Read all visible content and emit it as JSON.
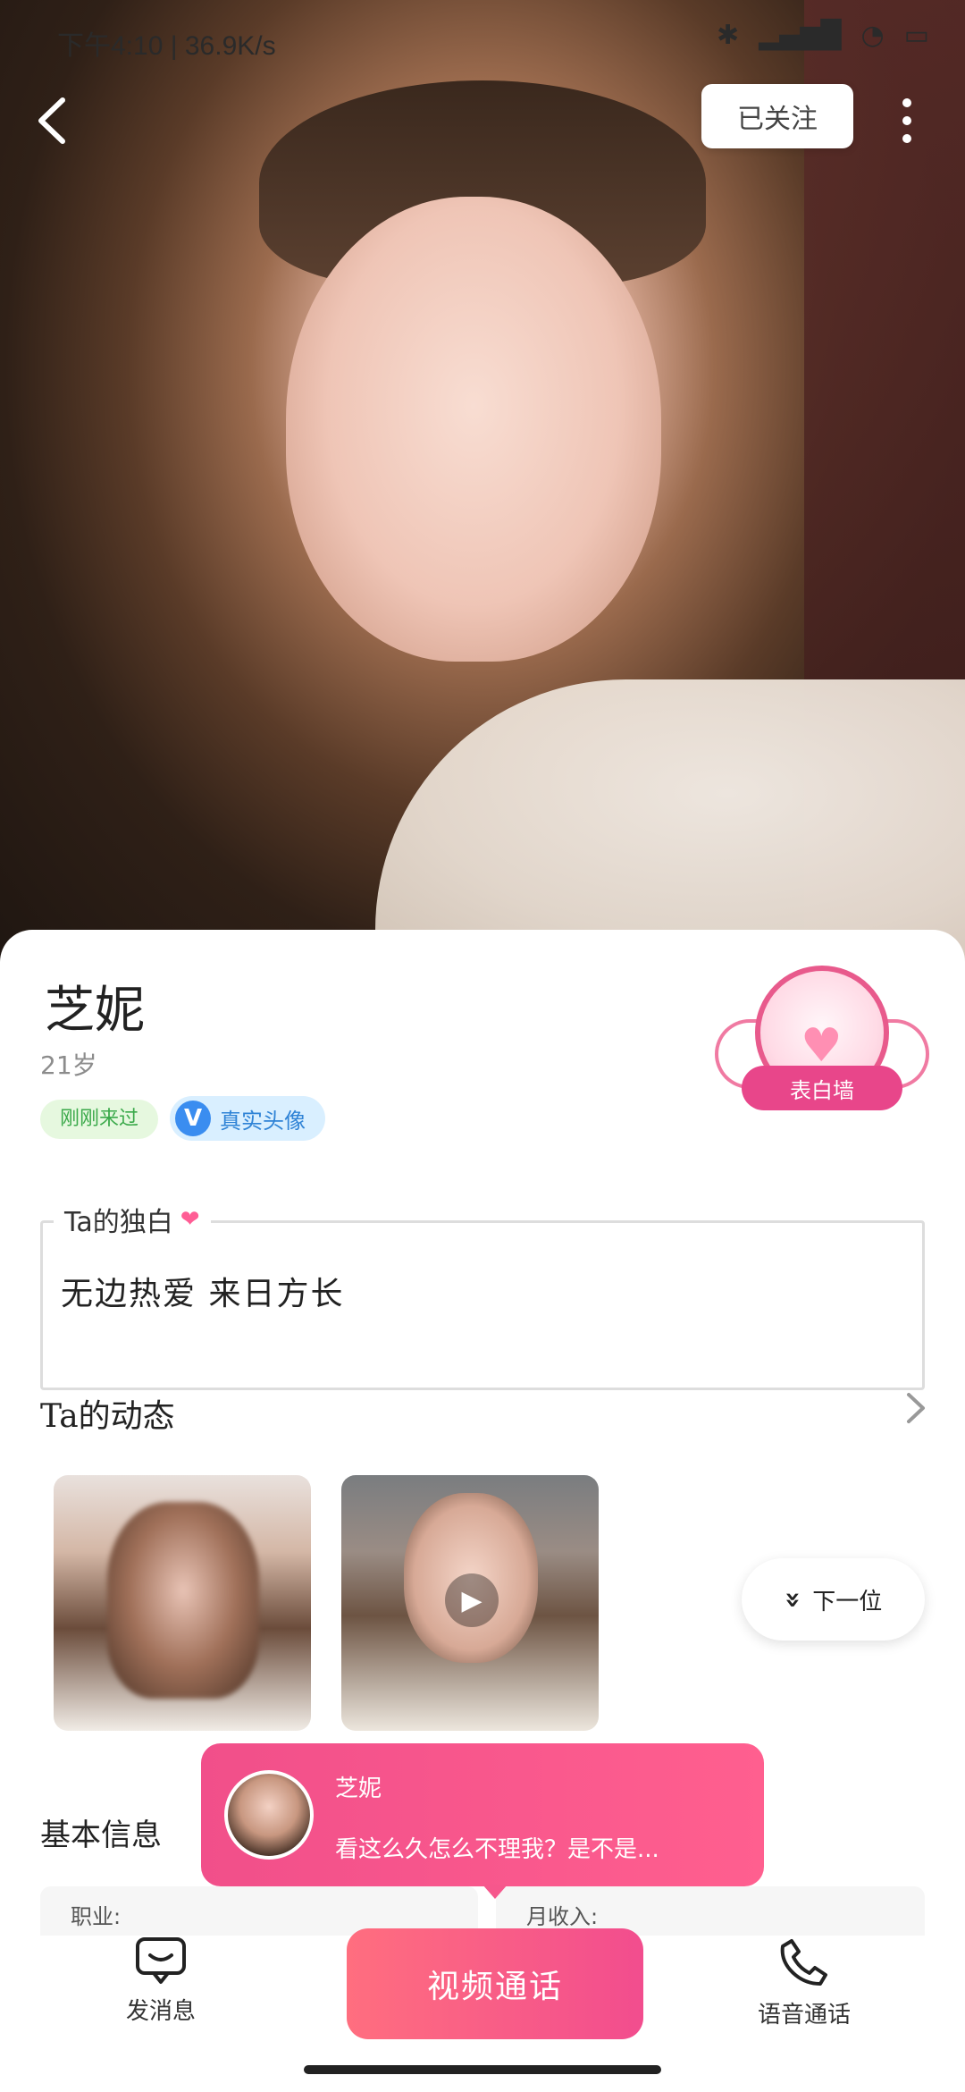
{
  "status_bar": {
    "time": "下午4:10",
    "network_speed": "36.9K/s"
  },
  "header": {
    "follow_label": "已关注"
  },
  "profile": {
    "name": "芝妮",
    "age": "21岁",
    "tags": {
      "recent": "刚刚来过",
      "verified_icon": "V",
      "verified_label": "真实头像"
    },
    "confession_wall": "表白墙"
  },
  "monologue": {
    "title": "Ta的独白",
    "text": "无边热爱 来日方长"
  },
  "moments": {
    "title": "Ta的动态"
  },
  "next_button": {
    "label": "下一位"
  },
  "basic_info": {
    "title": "基本信息",
    "job_label": "职业:",
    "income_label": "月收入:"
  },
  "toast": {
    "name": "芝妮",
    "message": "看这么久怎么不理我？是不是..."
  },
  "bottom_bar": {
    "message_label": "发消息",
    "video_call_label": "视频通话",
    "voice_call_label": "语音通话"
  },
  "colors": {
    "accent_pink": "#f24d8e",
    "verified_blue": "#3a8df0",
    "recent_green": "#3aa94a"
  },
  "icons": [
    "back-arrow-icon",
    "more-vertical-icon",
    "heart-icon",
    "chevron-right-icon",
    "double-chevron-down-icon",
    "play-icon",
    "message-bubble-icon",
    "phone-icon",
    "bluetooth-icon",
    "signal-icon",
    "wifi-icon",
    "battery-icon"
  ]
}
